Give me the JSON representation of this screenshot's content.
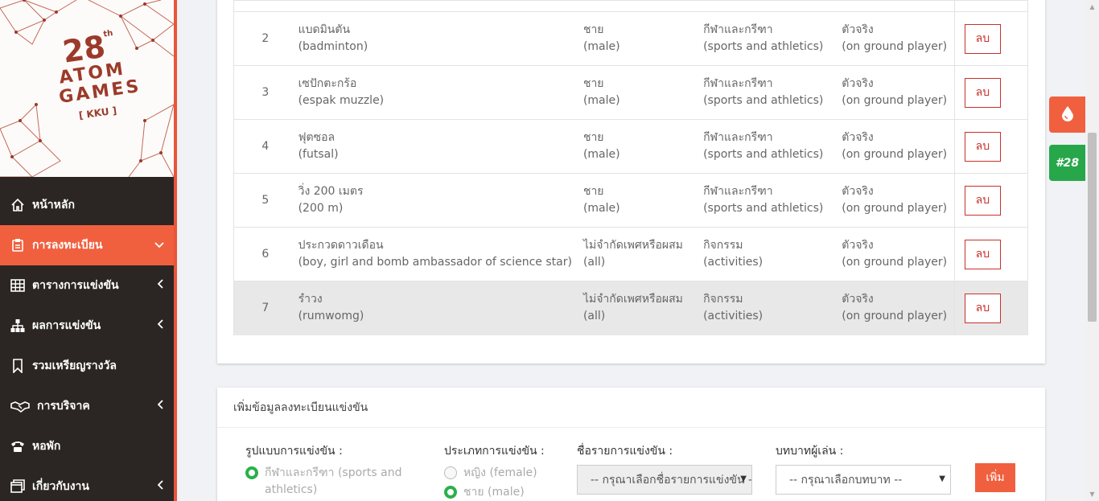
{
  "logo": {
    "number": "28",
    "suffix": "th",
    "line1": "ATOM",
    "line2": "GAMES",
    "tag": "[ KKU ]"
  },
  "nav": [
    {
      "label": "หน้าหลัก",
      "icon": "home-icon",
      "arrow": ""
    },
    {
      "label": "การลงทะเบียน",
      "icon": "register-icon",
      "arrow": "⌄",
      "active": true
    },
    {
      "label": "ตารางการแข่งขัน",
      "icon": "table-icon",
      "arrow": "‹"
    },
    {
      "label": "ผลการแข่งขัน",
      "icon": "sitemap-icon",
      "arrow": "‹"
    },
    {
      "label": "รวมเหรียญรางวัล",
      "icon": "bookmark-icon",
      "arrow": ""
    },
    {
      "label": "การบริจาค",
      "icon": "handshake-icon",
      "arrow": "‹"
    },
    {
      "label": "หอพัก",
      "icon": "phone-icon",
      "arrow": ""
    },
    {
      "label": "เกี่ยวกับงาน",
      "icon": "window-icon",
      "arrow": "‹"
    }
  ],
  "float": {
    "drop_icon": "drop-icon",
    "badge": "#28"
  },
  "table": {
    "delete_label": "ลบ",
    "rows": [
      {
        "no": "2",
        "sport_th": "แบดมินตัน",
        "sport_en": "(badminton)",
        "gender_th": "ชาย",
        "gender_en": "(male)",
        "type_th": "กีฬาและกรีฑา",
        "type_en": "(sports and athletics)",
        "role_th": "ตัวจริง",
        "role_en": "(on ground player)"
      },
      {
        "no": "3",
        "sport_th": "เซปักตะกร้อ",
        "sport_en": "(espak muzzle)",
        "gender_th": "ชาย",
        "gender_en": "(male)",
        "type_th": "กีฬาและกรีฑา",
        "type_en": "(sports and athletics)",
        "role_th": "ตัวจริง",
        "role_en": "(on ground player)"
      },
      {
        "no": "4",
        "sport_th": "ฟุตซอล",
        "sport_en": "(futsal)",
        "gender_th": "ชาย",
        "gender_en": "(male)",
        "type_th": "กีฬาและกรีฑา",
        "type_en": "(sports and athletics)",
        "role_th": "ตัวจริง",
        "role_en": "(on ground player)"
      },
      {
        "no": "5",
        "sport_th": "วิ่ง 200 เมตร",
        "sport_en": "(200 m)",
        "gender_th": "ชาย",
        "gender_en": "(male)",
        "type_th": "กีฬาและกรีฑา",
        "type_en": "(sports and athletics)",
        "role_th": "ตัวจริง",
        "role_en": "(on ground player)"
      },
      {
        "no": "6",
        "sport_th": "ประกวดดาวเดือน",
        "sport_en": "(boy, girl and bomb ambassador of science star)",
        "gender_th": "ไม่จำกัดเพศหรือผสม",
        "gender_en": "(all)",
        "type_th": "กิจกรรม",
        "type_en": "(activities)",
        "role_th": "ตัวจริง",
        "role_en": "(on ground player)"
      },
      {
        "no": "7",
        "sport_th": "รำวง",
        "sport_en": "(rumwomg)",
        "gender_th": "ไม่จำกัดเพศหรือผสม",
        "gender_en": "(all)",
        "type_th": "กิจกรรม",
        "type_en": "(activities)",
        "role_th": "ตัวจริง",
        "role_en": "(on ground player)"
      }
    ]
  },
  "form": {
    "title": "เพิ่มข้อมูลลงทะเบียนแข่งขัน",
    "format_label": "รูปแบบการแข่งขัน :",
    "format_option": "กีฬาและกรีฑา (sports and athletics)",
    "gender_label": "ประเภทการแข่งขัน :",
    "gender_female": "หญิง (female)",
    "gender_male": "ชาย (male)",
    "event_label": "ชื่อรายการแข่งขัน :",
    "event_placeholder": "-- กรุณาเลือกชื่อรายการแข่งขัน --",
    "role_label": "บทบาทผู้เล่น :",
    "role_placeholder": "-- กรุณาเลือกบทบาท --",
    "add_label": "เพิ่ม"
  }
}
